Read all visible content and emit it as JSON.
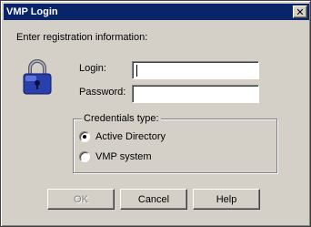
{
  "window": {
    "title": "VMP Login"
  },
  "instruction": "Enter registration information:",
  "form": {
    "login_label": "Login:",
    "login_value": "",
    "password_label": "Password:",
    "password_value": ""
  },
  "credentials": {
    "legend": "Credentials type:",
    "options": [
      {
        "label": "Active Directory",
        "selected": true
      },
      {
        "label": "VMP system",
        "selected": false
      }
    ]
  },
  "buttons": {
    "ok": "OK",
    "cancel": "Cancel",
    "help": "Help"
  },
  "icons": {
    "close": "close-icon",
    "lock": "padlock-icon"
  },
  "colors": {
    "titlebar": "#0a246a",
    "lock_blue": "#2a3fae"
  }
}
